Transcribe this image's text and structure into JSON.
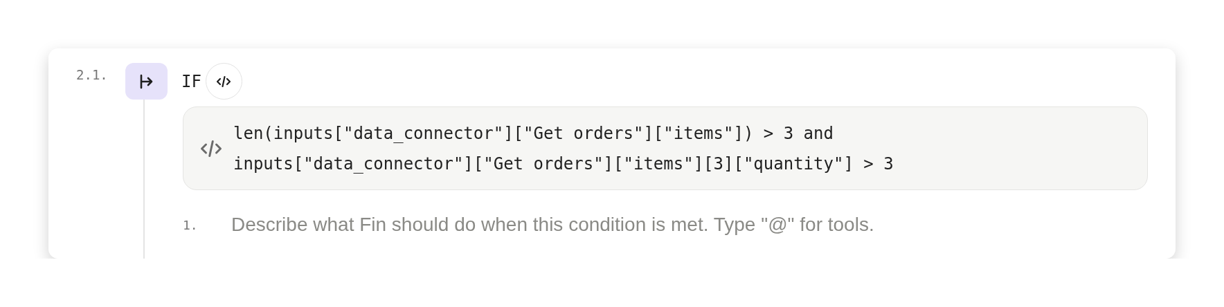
{
  "step": {
    "number": "2.1.",
    "keyword": "IF",
    "condition_lines": [
      "len(inputs[\"data_connector\"][\"Get orders\"][\"items\"]) > 3 and",
      "inputs[\"data_connector\"][\"Get orders\"][\"items\"][3][\"quantity\"] > 3"
    ],
    "substeps": [
      {
        "number": "1.",
        "placeholder": "Describe what Fin should do when this condition is met. Type \"@\" for tools."
      }
    ]
  }
}
